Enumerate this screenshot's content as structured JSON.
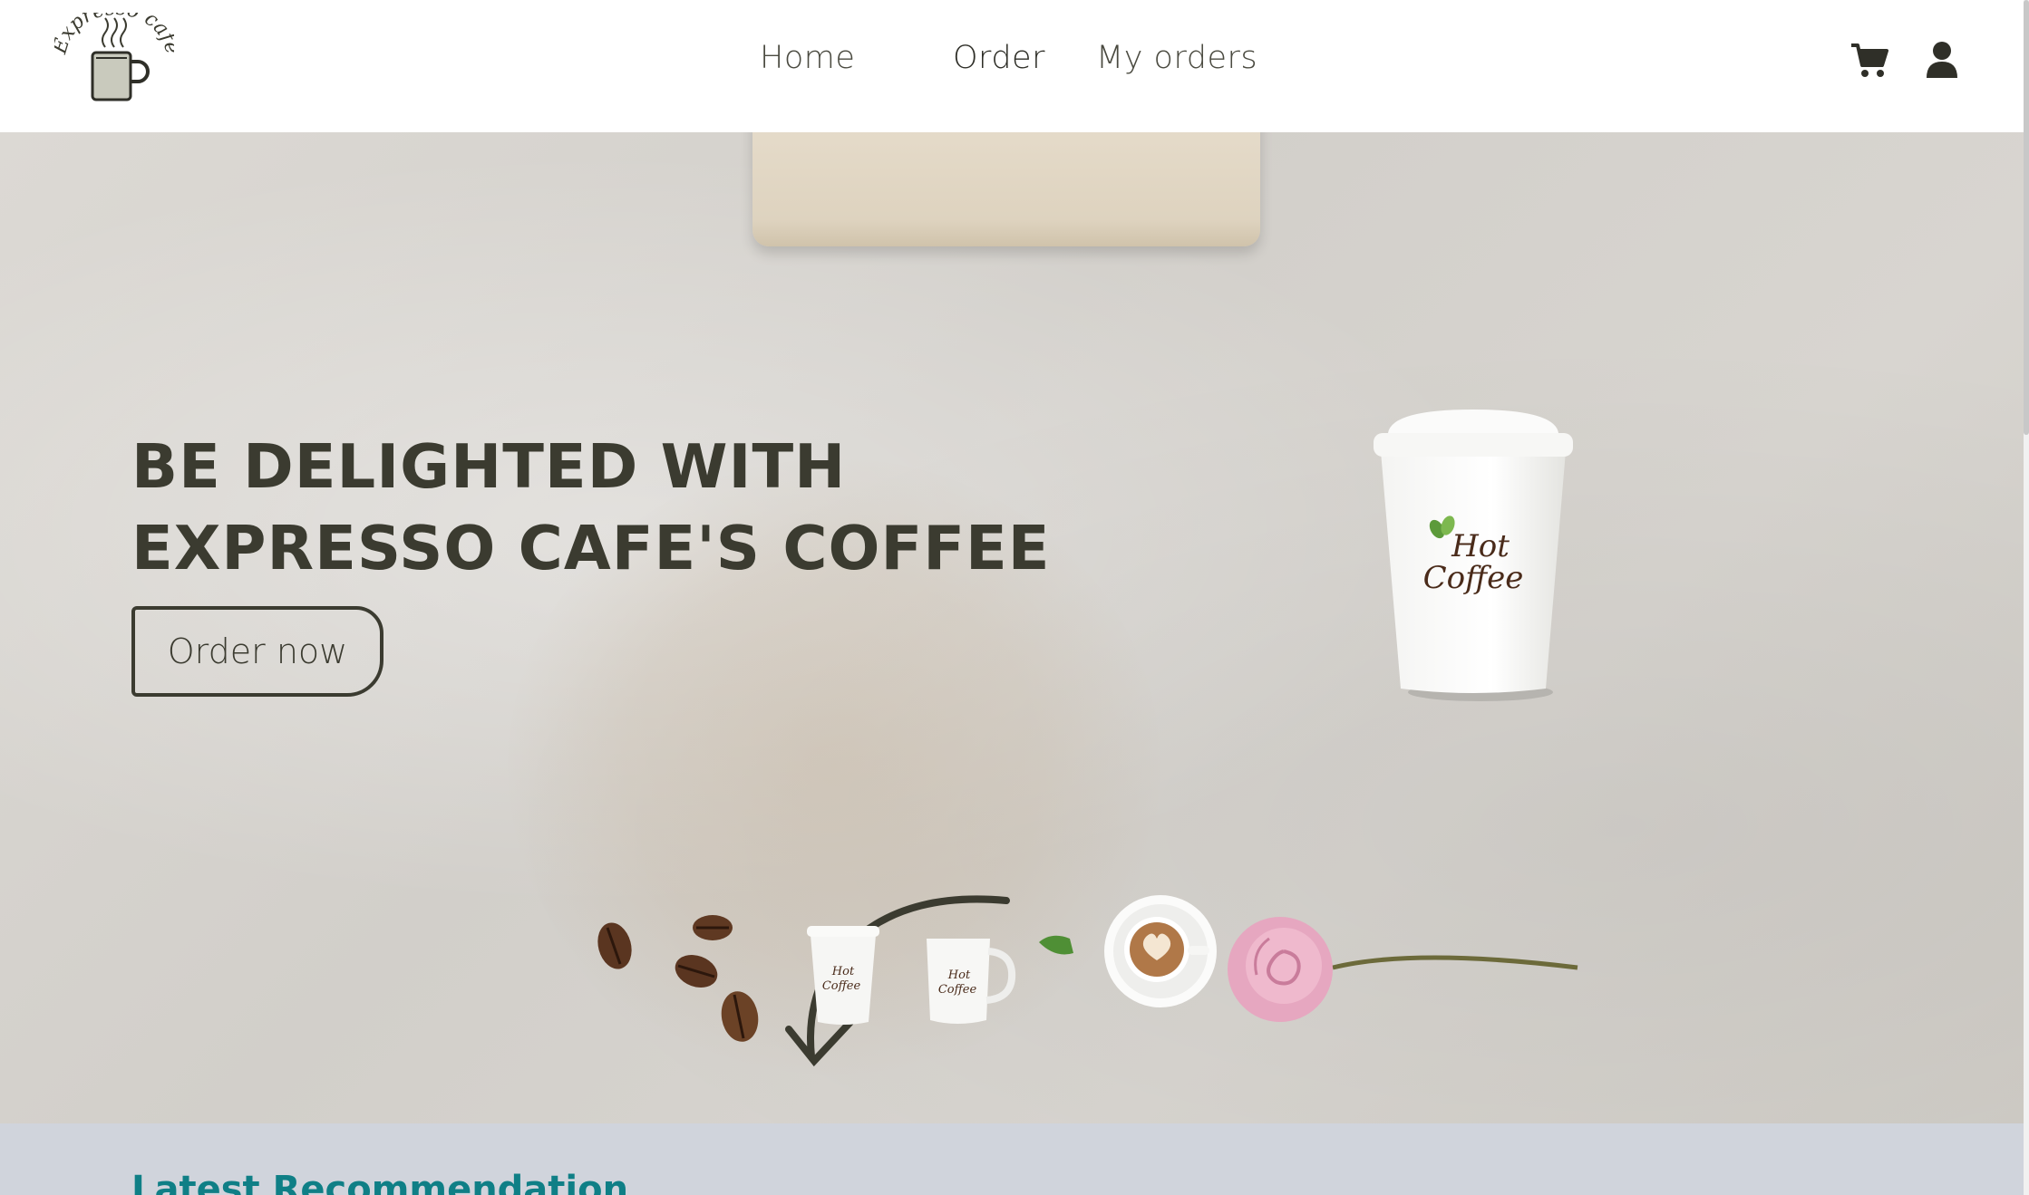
{
  "navbar": {
    "logo_text": "Expresso cafe",
    "links": {
      "home": "Home",
      "order": "Order",
      "my_orders": "My orders"
    },
    "icons": [
      "cart-icon",
      "user-icon"
    ]
  },
  "hero": {
    "title_line1": "BE DELIGHTED WITH",
    "title_line2": "EXPRESSO CAFE'S COFFEE",
    "cta_label": "Order now",
    "cup_text_line1": "Hot",
    "cup_text_line2": "Coffee"
  },
  "latest": {
    "title": "Latest Recommendation"
  },
  "colors": {
    "text_dark": "#3b3b30",
    "accent_teal": "#0f7f86",
    "section_bg": "#d0d4dc",
    "hero_bg": "#d6d3ce"
  }
}
